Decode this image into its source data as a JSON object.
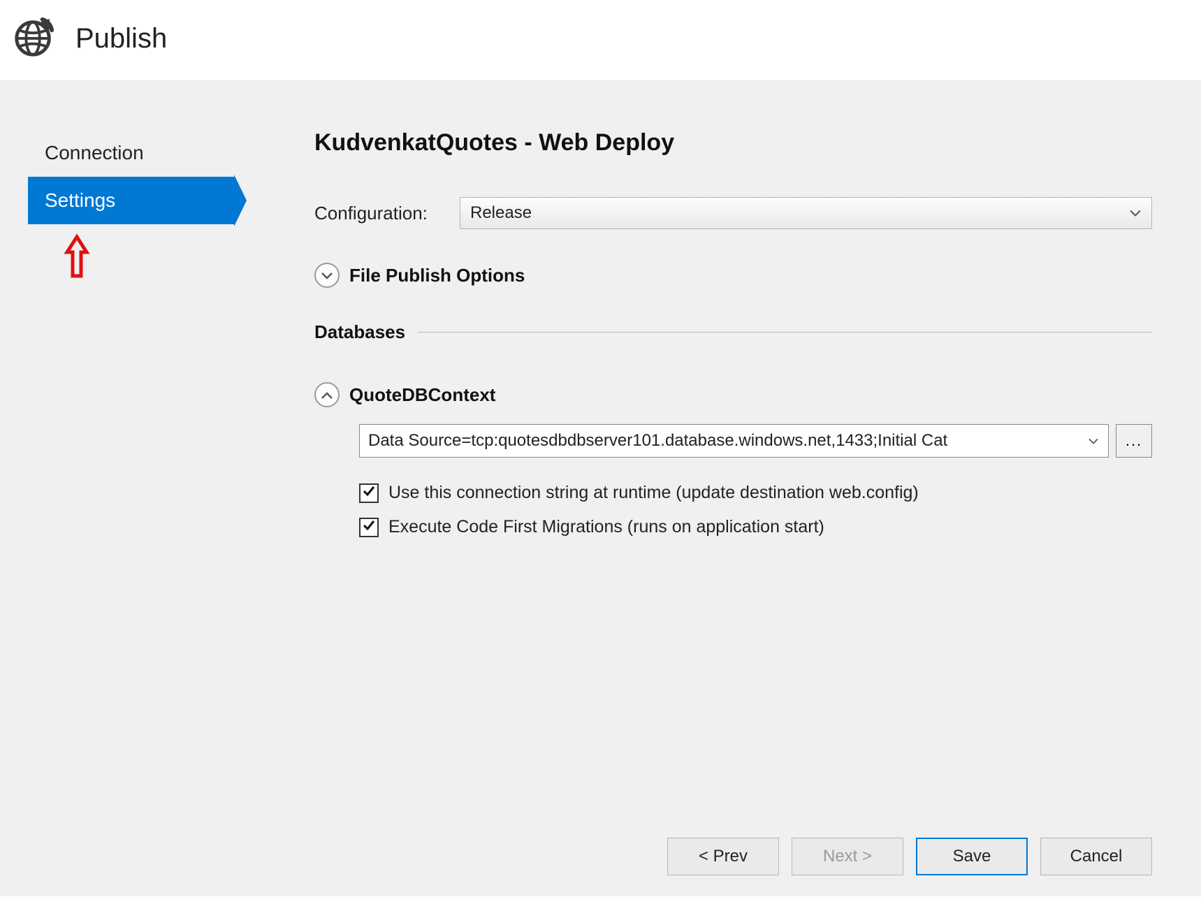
{
  "header": {
    "title": "Publish"
  },
  "sidebar": {
    "items": [
      {
        "label": "Connection",
        "active": false
      },
      {
        "label": "Settings",
        "active": true
      }
    ]
  },
  "main": {
    "heading": "KudvenkatQuotes - Web Deploy",
    "config_label": "Configuration:",
    "config_value": "Release",
    "file_publish_label": "File Publish Options",
    "databases_label": "Databases",
    "db_context_label": "QuoteDBContext",
    "conn_string": "Data Source=tcp:quotesdbdbserver101.database.windows.net,1433;Initial Cat",
    "browse_label": "...",
    "check_runtime": "Use this connection string at runtime (update destination web.config)",
    "check_migrations": "Execute Code First Migrations (runs on application start)"
  },
  "footer": {
    "prev": "< Prev",
    "next": "Next >",
    "save": "Save",
    "cancel": "Cancel"
  }
}
